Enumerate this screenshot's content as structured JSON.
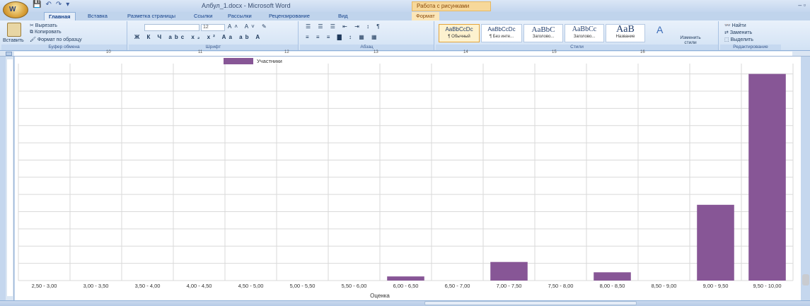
{
  "app": {
    "office_button_label": "W",
    "window_title": "Албул_1.docx - Microsoft Word",
    "context_tool_title": "Работа с рисунками",
    "window_controls": "–  ▫"
  },
  "tabs": [
    {
      "label": "Главная"
    },
    {
      "label": "Вставка"
    },
    {
      "label": "Разметка страницы"
    },
    {
      "label": "Ссылки"
    },
    {
      "label": "Рассылки"
    },
    {
      "label": "Рецензирование"
    },
    {
      "label": "Вид"
    },
    {
      "label": "Формат"
    }
  ],
  "ribbon": {
    "clipboard": {
      "paste": "Вставить",
      "cut": "✂ Вырезать",
      "copy": "⧉ Копировать",
      "format_painter": "🖌 Формат по образцу",
      "label": "Буфер обмена"
    },
    "font": {
      "font_name": "",
      "font_size": "12",
      "label": "Шрифт",
      "row2": "Ж  К  Ч  abc  x₂  x²  Aa  ab  A"
    },
    "paragraph": {
      "row1": "☰ ☰ ☰ ⇤ ⇥ ↕ ¶",
      "row2": "≡ ≡ ≡ ▇ ↕ ▦ ▦",
      "label": "Абзац"
    },
    "styles": {
      "items": [
        {
          "sample": "AaBbCcDc",
          "name": "¶ Обычный"
        },
        {
          "sample": "AaBbCcDc",
          "name": "¶ Без инте..."
        },
        {
          "sample": "AaBbC",
          "name": "Заголово..."
        },
        {
          "sample": "AaBbCc",
          "name": "Заголово..."
        },
        {
          "sample": "AaB",
          "name": "Название"
        }
      ],
      "change_styles": "Изменить стили",
      "label": "Стили"
    },
    "editing": {
      "find": "Найти",
      "replace": "Заменить",
      "select": "Выделить",
      "label": "Редактирование"
    }
  },
  "ruler": {
    "numbers": [
      "10",
      "11",
      "12",
      "13",
      "14",
      "15",
      "16"
    ]
  },
  "chart_data": {
    "type": "bar",
    "categories": [
      "2,50 - 3,00",
      "3,00 - 3,50",
      "3,50 - 4,00",
      "4,00 - 4,50",
      "4,50 - 5,00",
      "5,00 - 5,50",
      "5,50 - 6,00",
      "6,00 - 6,50",
      "6,50 - 7,00",
      "7,00 - 7,50",
      "7,50 - 8,00",
      "8,00 - 8,50",
      "8,50 - 9,00",
      "9,00 - 9,50",
      "9,50 - 10,00"
    ],
    "series": [
      {
        "name": "Участники",
        "values": [
          0,
          0,
          0,
          0,
          0,
          0,
          0,
          0.6,
          0,
          2.7,
          0,
          1.2,
          0,
          11,
          30
        ]
      }
    ],
    "xlabel": "Оценка",
    "ylim": [
      0,
      31.5
    ],
    "grid": true,
    "legend": "top-left",
    "colors": {
      "bar": "#875696",
      "grid": "#d9d9d9"
    }
  }
}
